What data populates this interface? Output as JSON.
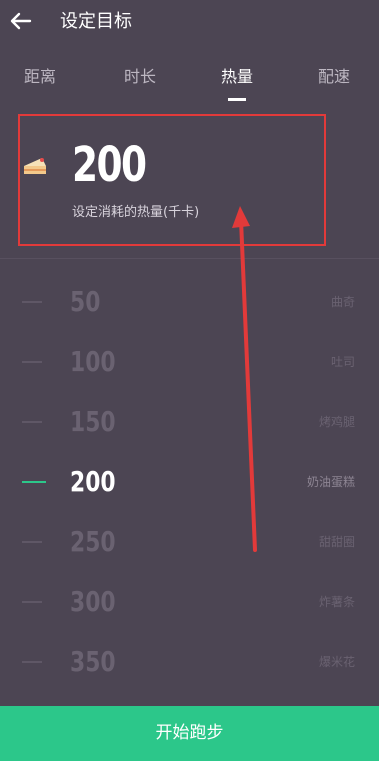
{
  "header": {
    "title": "设定目标",
    "back_icon": "arrow-left-icon"
  },
  "tabs": [
    {
      "label": "距离",
      "active": false
    },
    {
      "label": "时长",
      "active": false
    },
    {
      "label": "热量",
      "active": true
    },
    {
      "label": "配速",
      "active": false
    }
  ],
  "summary": {
    "icon": "cake-icon",
    "value": "200",
    "caption": "设定消耗的热量(千卡)"
  },
  "picker": {
    "selected_value": "200",
    "options": [
      {
        "value": "50",
        "food": "曲奇"
      },
      {
        "value": "100",
        "food": "吐司"
      },
      {
        "value": "150",
        "food": "烤鸡腿"
      },
      {
        "value": "200",
        "food": "奶油蛋糕"
      },
      {
        "value": "250",
        "food": "甜甜圈"
      },
      {
        "value": "300",
        "food": "炸薯条"
      },
      {
        "value": "350",
        "food": "爆米花"
      }
    ]
  },
  "footer": {
    "start_label": "开始跑步"
  },
  "colors": {
    "background": "#4c4553",
    "accent": "#2cc78a",
    "annotation_red": "#e23a3a"
  }
}
